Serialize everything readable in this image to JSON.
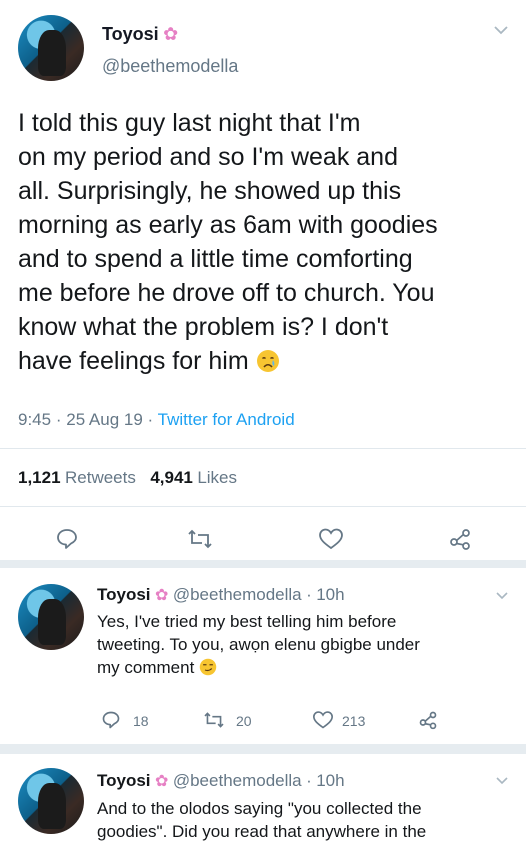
{
  "main_tweet": {
    "author_name": "Toyosi",
    "author_handle": "@beethemodella",
    "text_lines": [
      "I told this guy last night that I'm",
      "on my period and so I'm weak and",
      "all. Surprisingly, he showed up this",
      "morning as early as 6am with goodies",
      "and to spend a little time comforting",
      "me before he drove off to church. You",
      "know what the problem is? I don't",
      "have feelings for him"
    ],
    "time": "9:45",
    "date": "25 Aug 19",
    "source": "Twitter for Android",
    "retweets_count": "1,121",
    "retweets_label": "Retweets",
    "likes_count": "4,941",
    "likes_label": "Likes",
    "emoji": "crying-face"
  },
  "replies": [
    {
      "author_name": "Toyosi",
      "author_handle": "@beethemodella",
      "age": "10h",
      "text_lines": [
        "Yes, I've tried my best telling him before",
        "tweeting. To you, awọn elenu gbigbe under",
        "my comment"
      ],
      "emoji": "smirking-face",
      "reply_count": "18",
      "retweet_count": "20",
      "like_count": "213"
    },
    {
      "author_name": "Toyosi",
      "author_handle": "@beethemodella",
      "age": "10h",
      "text_lines": [
        "And to the olodos saying \"you collected the",
        "goodies\". Did you read that anywhere in the"
      ]
    }
  ],
  "colors": {
    "link": "#1da1f2",
    "muted": "#657786",
    "divider": "#e1e8ed",
    "flower": "#e680c4"
  }
}
